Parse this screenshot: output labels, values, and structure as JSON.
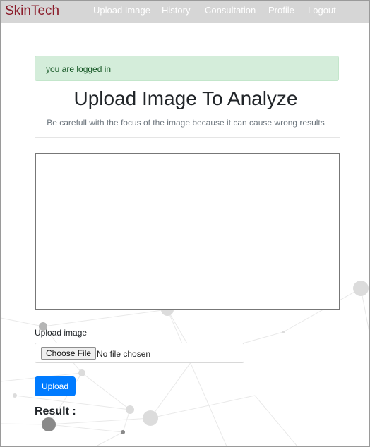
{
  "navbar": {
    "brand": "SkinTech",
    "links": [
      {
        "label": "Upload Image"
      },
      {
        "label": "History"
      },
      {
        "label": "Consultation"
      },
      {
        "label": "Profile"
      },
      {
        "label": "Logout"
      }
    ]
  },
  "alert": {
    "message": "you are logged in",
    "color": "#d4edda"
  },
  "main": {
    "title": "Upload Image To Analyze",
    "subtitle": "Be carefull with the focus of the image because it can cause wrong results",
    "upload_label": "Upload image",
    "file_input": {
      "button_label": "Choose File",
      "status": "No file chosen"
    },
    "upload_button": "Upload",
    "result_label": "Result :"
  },
  "colors": {
    "brand": "#8b1c2a",
    "navbar_bg": "#d6d6d6",
    "primary": "#007bff"
  }
}
